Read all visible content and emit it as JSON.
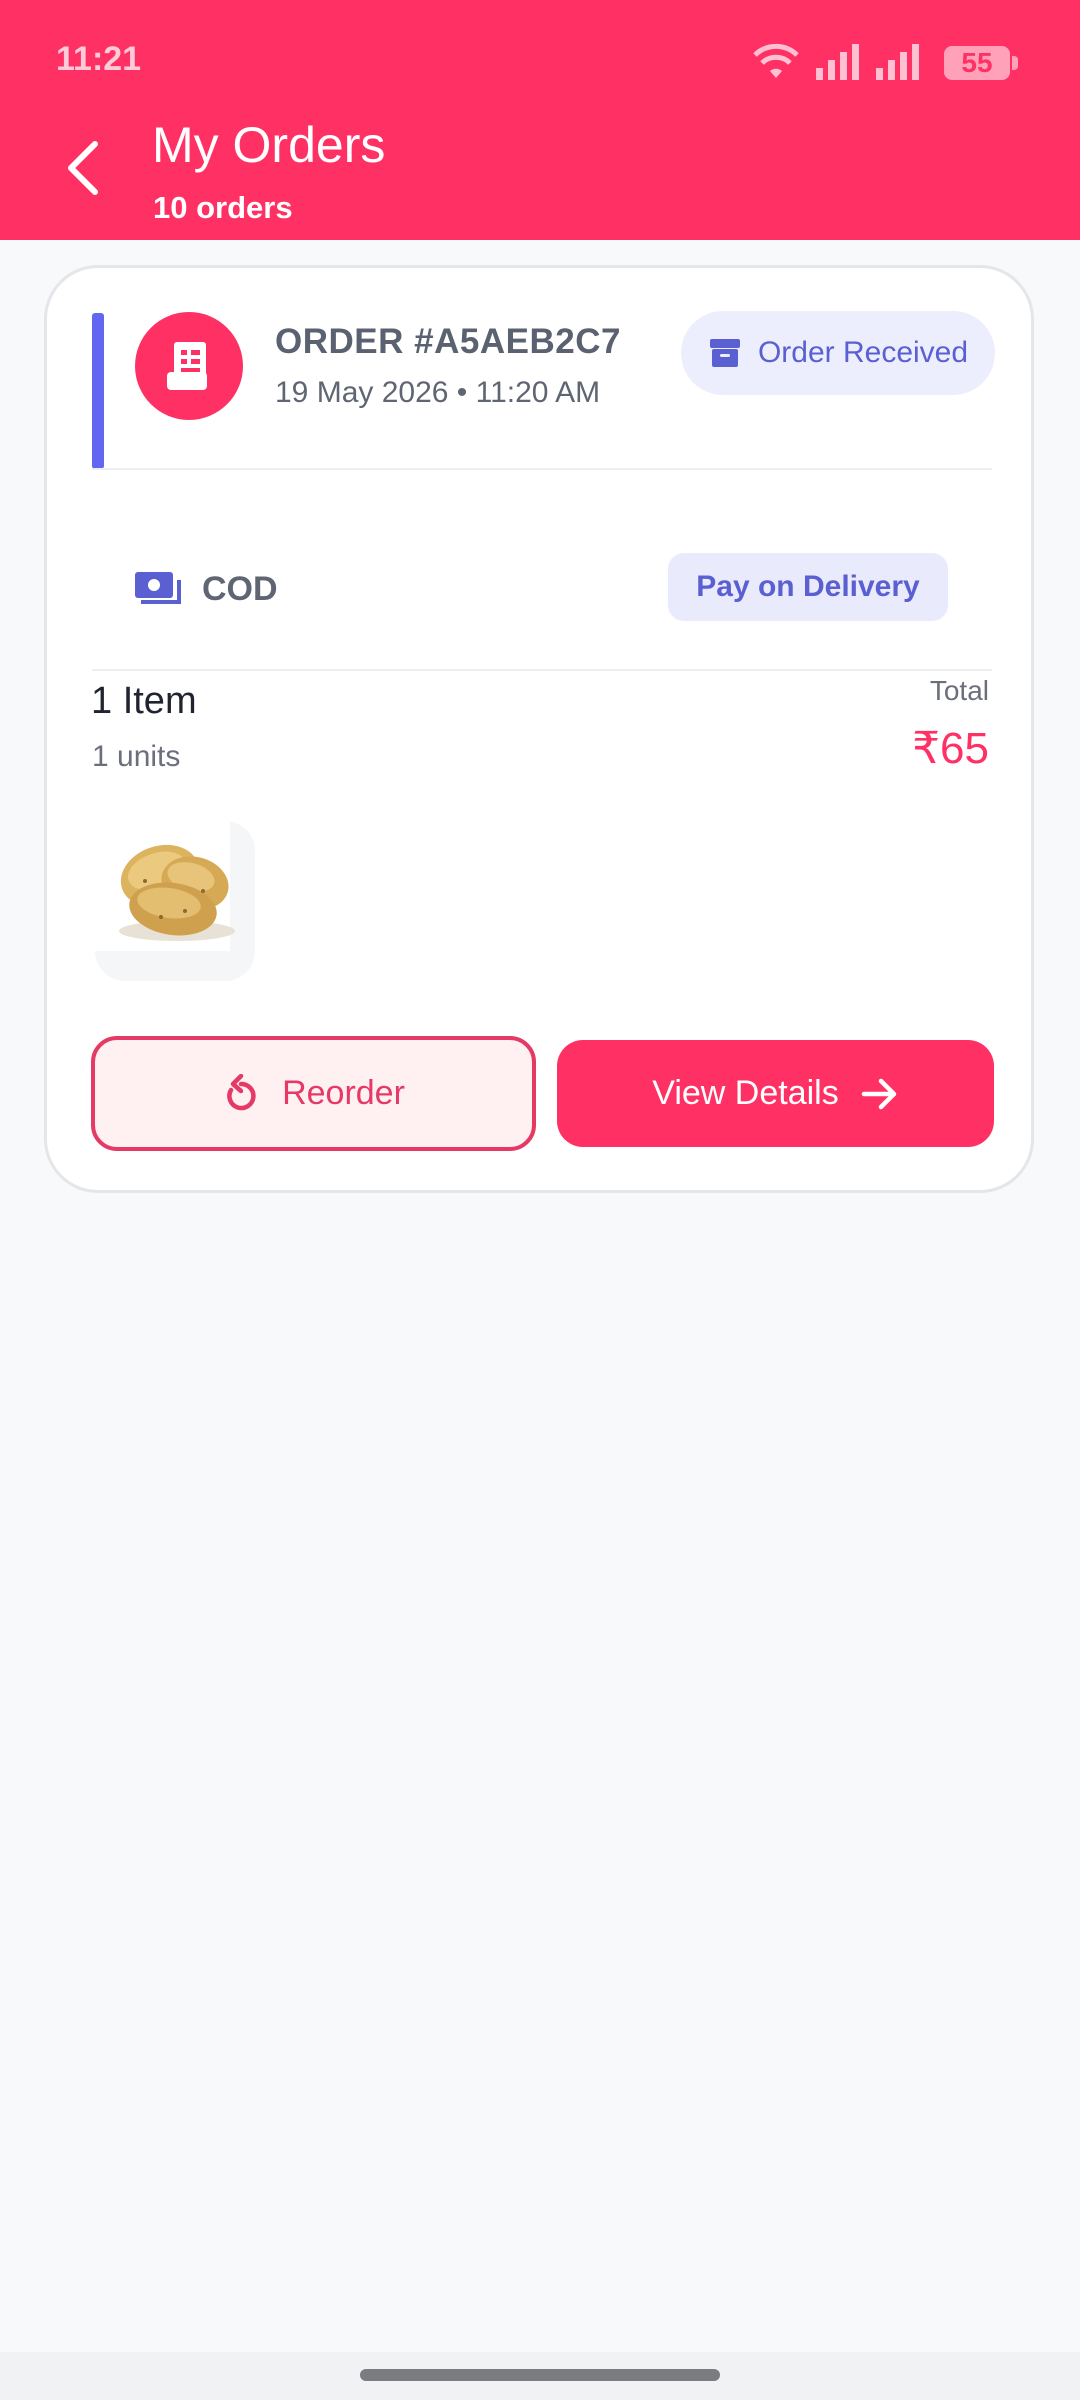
{
  "status_bar": {
    "time": "11:21",
    "battery": "55"
  },
  "header": {
    "title": "My Orders",
    "subtitle": "10 orders"
  },
  "order": {
    "number": "ORDER #A5AEB2C7",
    "date": "19 May 2026 • 11:20 AM",
    "status": "Order Received",
    "payment_method": "COD",
    "payment_note": "Pay on Delivery",
    "item_count": "1 Item",
    "units": "1 units",
    "total_label": "Total",
    "total": "₹65",
    "reorder_label": "Reorder",
    "details_label": "View Details"
  },
  "colors": {
    "primary": "#ff3164",
    "accent": "#6366f1",
    "status_pill_bg": "#eceefd",
    "background": "#f8f9fb"
  }
}
